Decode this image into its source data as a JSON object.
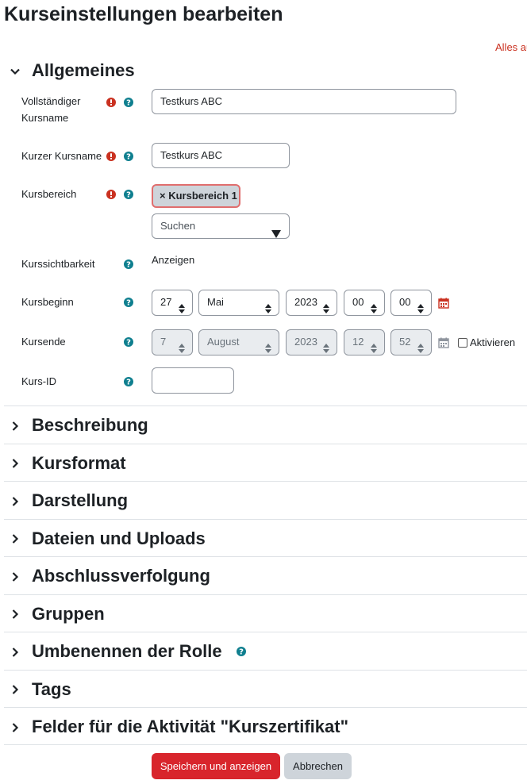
{
  "page": {
    "title": "Kurseinstellungen bearbeiten",
    "expand_all": "Alles au"
  },
  "general": {
    "title": "Allgemeines",
    "fullname": {
      "label_line1": "Vollständiger",
      "label_line2": "Kursname",
      "value": "Testkurs ABC"
    },
    "shortname": {
      "label": "Kurzer Kursname",
      "value": "Testkurs ABC"
    },
    "category": {
      "label": "Kursbereich",
      "tag": "× Kursbereich 1",
      "search_placeholder": "Suchen"
    },
    "visibility": {
      "label": "Kurssichtbarkeit",
      "value": "Anzeigen"
    },
    "startdate": {
      "label": "Kursbeginn",
      "day": "27",
      "month": "Mai",
      "year": "2023",
      "hour": "00",
      "minute": "00"
    },
    "enddate": {
      "label": "Kursende",
      "day": "7",
      "month": "August",
      "year": "2023",
      "hour": "12",
      "minute": "52",
      "enable_label": "Aktivieren",
      "enabled": false
    },
    "idnumber": {
      "label": "Kurs-ID",
      "value": ""
    }
  },
  "sections": [
    {
      "title": "Beschreibung"
    },
    {
      "title": "Kursformat"
    },
    {
      "title": "Darstellung"
    },
    {
      "title": "Dateien und Uploads"
    },
    {
      "title": "Abschlussverfolgung"
    },
    {
      "title": "Gruppen"
    },
    {
      "title": "Umbenennen der Rolle"
    },
    {
      "title": "Tags"
    },
    {
      "title": "Felder für die Aktivität \"Kurszertifikat\""
    }
  ],
  "buttons": {
    "save": "Speichern und anzeigen",
    "cancel": "Abbrechen"
  },
  "colors": {
    "accent": "#d8252c",
    "required": "#ca3120",
    "help": "#0f6cbf"
  },
  "icons": {
    "required": "exclamation-circle-icon",
    "help": "question-circle-icon",
    "calendar": "calendar-icon",
    "chevron_down": "chevron-down-icon",
    "chevron_right": "chevron-right-icon"
  }
}
